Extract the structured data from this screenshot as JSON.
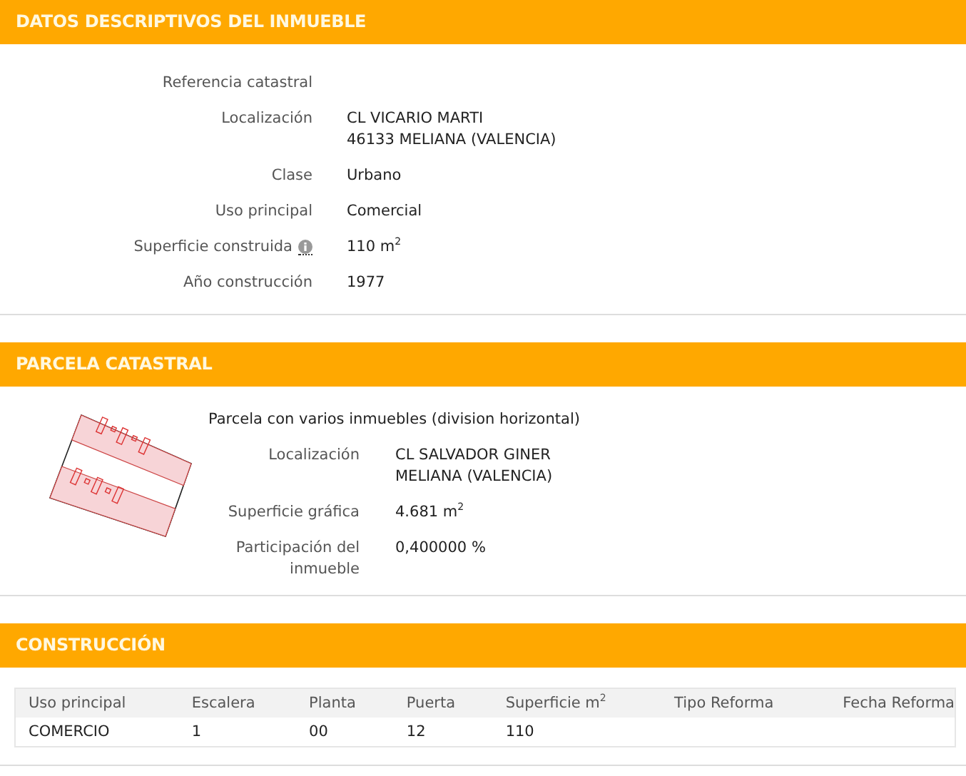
{
  "descriptive": {
    "title": "DATOS DESCRIPTIVOS DEL INMUEBLE",
    "fields": [
      {
        "label": "Referencia catastral"
      },
      {
        "label": "Localización",
        "lines": [
          "CL VICARIO MARTI",
          "46133 MELIANA (VALENCIA)"
        ]
      },
      {
        "label": "Clase",
        "lines": [
          "Urbano"
        ]
      },
      {
        "label": "Uso principal",
        "lines": [
          "Comercial"
        ]
      },
      {
        "label": "Superficie construida",
        "info": true,
        "lines": [
          "110 m$^{2}$"
        ]
      },
      {
        "label": "Año construcción",
        "lines": [
          "1977"
        ]
      }
    ]
  },
  "parcel": {
    "title": "PARCELA CATASTRAL",
    "description": "Parcela con varios inmuebles (division horizontal)",
    "fields": [
      {
        "label": "Localización",
        "lines": [
          "CL SALVADOR GINER",
          "MELIANA (VALENCIA)"
        ]
      },
      {
        "label": "Superficie gráfica",
        "lines": [
          "4.681 m$^{2}$"
        ]
      },
      {
        "label": "Participación del inmueble",
        "lines": [
          "0,400000 %"
        ]
      }
    ]
  },
  "construction": {
    "title": "CONSTRUCCIÓN",
    "table": {
      "columns": [
        "Uso principal",
        "Escalera",
        "Planta",
        "Puerta",
        "Superficie m$^{2}$",
        "Tipo Reforma",
        "Fecha Reforma"
      ],
      "rows": [
        [
          "COMERCIO",
          "1",
          "00",
          "12",
          "110",
          "",
          ""
        ]
      ]
    }
  }
}
